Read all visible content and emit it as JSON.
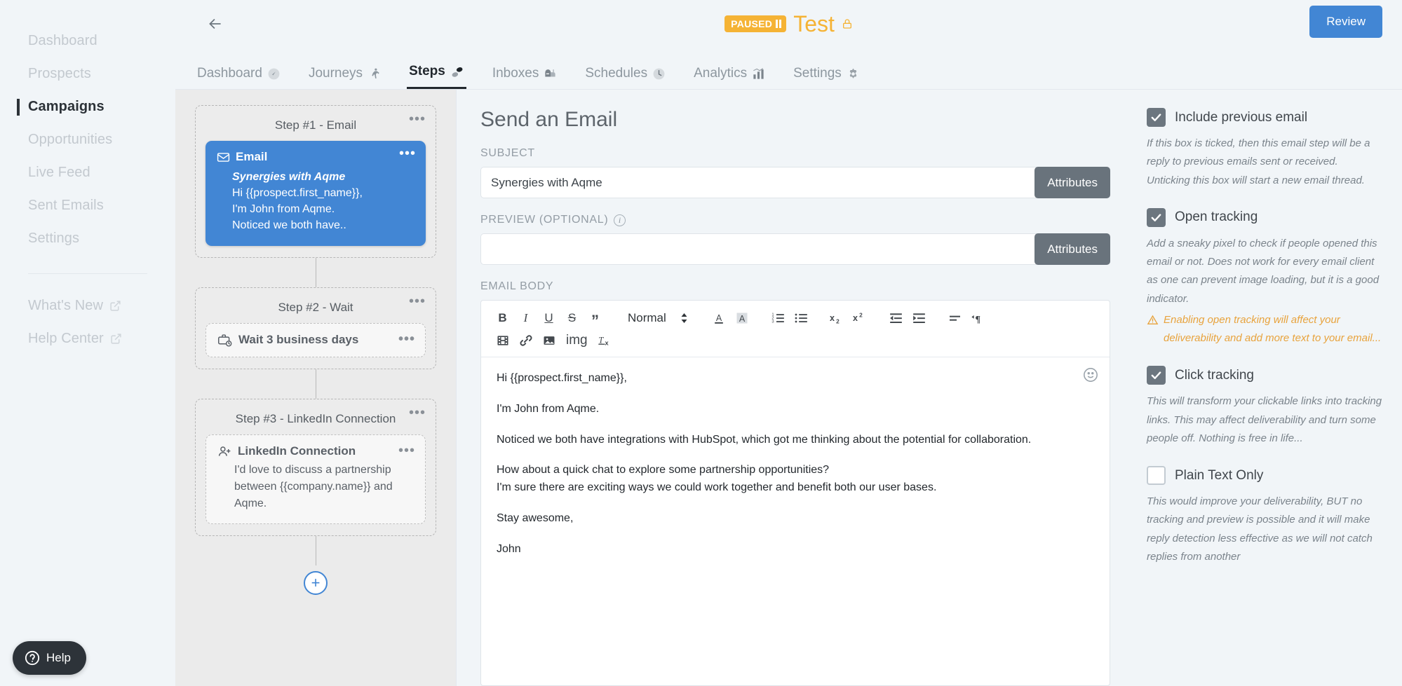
{
  "sidebar": {
    "items": [
      {
        "label": "Dashboard",
        "active": false
      },
      {
        "label": "Prospects",
        "active": false
      },
      {
        "label": "Campaigns",
        "active": true
      },
      {
        "label": "Opportunities",
        "active": false
      },
      {
        "label": "Live Feed",
        "active": false
      },
      {
        "label": "Sent Emails",
        "active": false
      },
      {
        "label": "Settings",
        "active": false
      }
    ],
    "external": [
      {
        "label": "What's New"
      },
      {
        "label": "Help Center"
      }
    ],
    "help_widget": "Help"
  },
  "header": {
    "back_label": "Back",
    "status_badge": "PAUSED",
    "campaign_name": "Test",
    "review_button": "Review",
    "accent_color": "#f5b335",
    "primary_color": "#4286d4"
  },
  "tabs": [
    {
      "label": "Dashboard",
      "icon": "gauge-icon",
      "active": false
    },
    {
      "label": "Journeys",
      "icon": "runner-icon",
      "active": false
    },
    {
      "label": "Steps",
      "icon": "footprints-icon",
      "active": true
    },
    {
      "label": "Inboxes",
      "icon": "mailbox-icon",
      "active": false
    },
    {
      "label": "Schedules",
      "icon": "clock-icon",
      "active": false
    },
    {
      "label": "Analytics",
      "icon": "bar-chart-icon",
      "active": false
    },
    {
      "label": "Settings",
      "icon": "gear-icon",
      "active": false
    }
  ],
  "steps": {
    "step1": {
      "title": "Step #1 - Email",
      "card_type": "Email",
      "subject": "Synergies with Aqme",
      "lines": [
        "Hi {{prospect.first_name}},",
        "I'm John from Aqme.",
        "Noticed we both have.."
      ]
    },
    "step2": {
      "title": "Step #2 - Wait",
      "card_label": "Wait 3 business days"
    },
    "step3": {
      "title": "Step #3 - LinkedIn Connection",
      "card_label": "LinkedIn Connection",
      "body": "I'd love to discuss a partner­ship between {{company.­name}} and Aqme."
    },
    "add_step": "+"
  },
  "editor": {
    "title": "Send an Email",
    "subject_label": "SUBJECT",
    "subject_value": "Synergies with Aqme",
    "subject_placeholder": "",
    "preview_label": "PREVIEW (OPTIONAL)",
    "preview_value": "",
    "preview_placeholder": "",
    "attributes_button": "Attributes",
    "body_label": "EMAIL BODY",
    "toolbar": {
      "bold": "B",
      "italic": "I",
      "underline": "U",
      "strike": "S",
      "blockquote": "”",
      "format_value": "Normal",
      "video": "video-icon",
      "link": "link-icon",
      "image": "image-icon",
      "img_text": "img",
      "clear_format": "clear-formatting-icon"
    },
    "body_paragraphs": [
      "Hi {{prospect.first_name}},",
      "I'm John from Aqme.",
      "Noticed we both have integrations with HubSpot, which got me thinking about the potential for collaboration.",
      "How about a quick chat to explore some partnership opportunities?",
      "I'm sure there are exciting ways we could work together and benefit both our user bases.",
      "Stay awesome,",
      "John"
    ]
  },
  "options": [
    {
      "label": "Include previous email",
      "checked": true,
      "description": "If this box is ticked, then this email step will be a reply to previous emails sent or received. Unticking this box will start a new email thread.",
      "warning": ""
    },
    {
      "label": "Open tracking",
      "checked": true,
      "description": "Add a sneaky pixel to check if people opened this email or not. Does not work for every email client as one can prevent image loading, but it is a good indicator.",
      "warning": "Enabling open tracking will affect your deliverability and add more text to your email..."
    },
    {
      "label": "Click tracking",
      "checked": true,
      "description": "This will transform your clickable links into tracking links. This may affect deliverability and turn some people off. Nothing is free in life...",
      "warning": ""
    },
    {
      "label": "Plain Text Only",
      "checked": false,
      "description": "This would improve your deliverability, BUT no tracking and preview is possible and it will make reply detection less effective as we will not catch replies from another",
      "warning": ""
    }
  ]
}
